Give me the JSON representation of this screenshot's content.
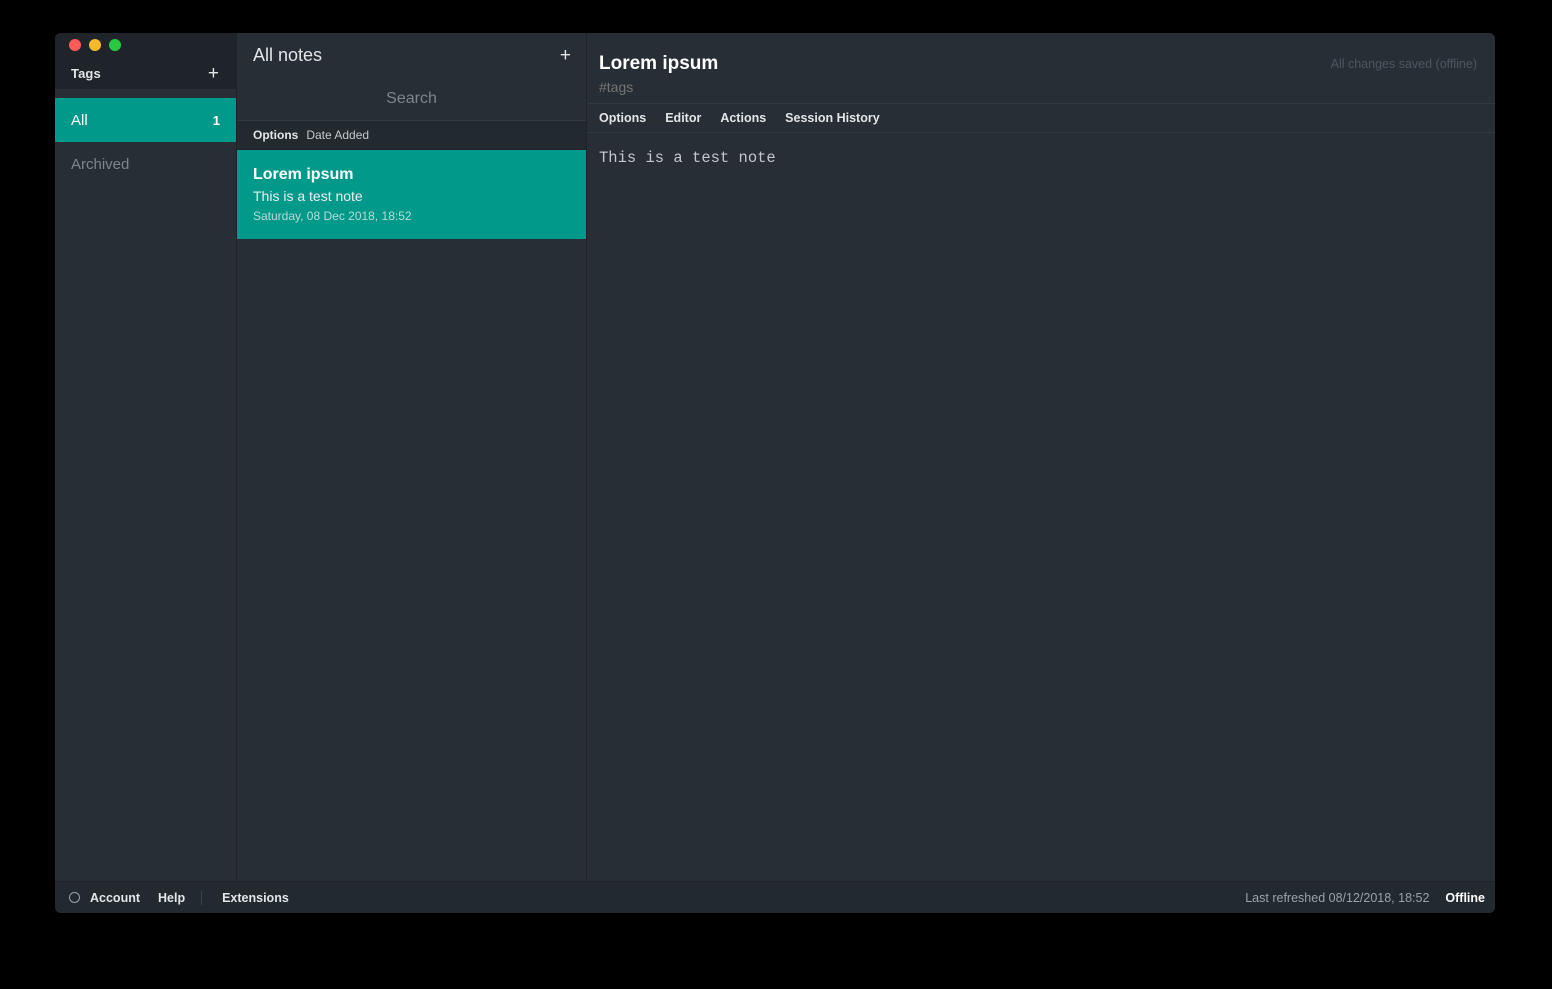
{
  "window": {
    "traffic_lights": [
      "close",
      "minimize",
      "maximize"
    ]
  },
  "sidebar": {
    "header": {
      "title": "Tags",
      "add_label": "+"
    },
    "items": [
      {
        "label": "All",
        "count": "1",
        "selected": true
      },
      {
        "label": "Archived",
        "count": "",
        "selected": false
      }
    ]
  },
  "notes_panel": {
    "title": "All notes",
    "add_label": "+",
    "search": {
      "value": "",
      "placeholder": "Search"
    },
    "options_bar": {
      "options_label": "Options",
      "sort_value": "Date Added"
    },
    "notes": [
      {
        "title": "Lorem ipsum",
        "preview": "This is a test note",
        "date": "Saturday, 08 Dec 2018, 18:52",
        "selected": true
      }
    ]
  },
  "editor": {
    "title": "Lorem ipsum",
    "title_placeholder": "Title",
    "tags": "",
    "tags_placeholder": "#tags",
    "save_status": "All changes saved (offline)",
    "menu": [
      {
        "label": "Options"
      },
      {
        "label": "Editor"
      },
      {
        "label": "Actions"
      },
      {
        "label": "Session History"
      }
    ],
    "content": "This is a test note",
    "content_placeholder": ""
  },
  "footer": {
    "account_label": "Account",
    "help_label": "Help",
    "extensions_label": "Extensions",
    "last_refreshed": "Last refreshed 08/12/2018, 18:52",
    "offline_status": "Offline"
  },
  "colors": {
    "accent_teal": "#00998a",
    "background_dark": "#272e35",
    "chrome_dark": "#1e242a",
    "bar_dark": "#222a30",
    "text_primary": "#e3e5e7",
    "text_muted": "#7e858c"
  }
}
